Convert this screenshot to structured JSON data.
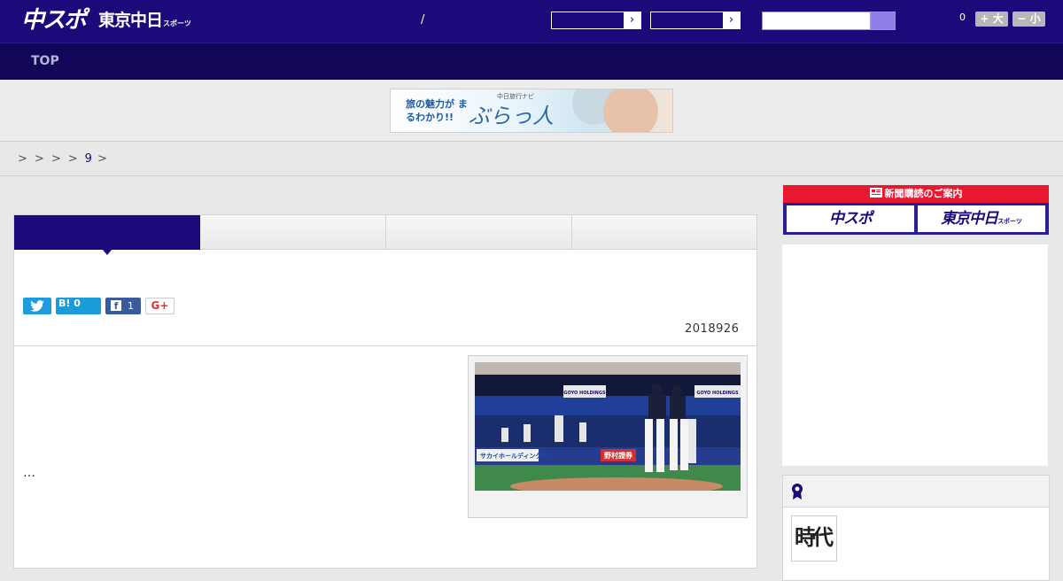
{
  "header": {
    "logo_main": "中スポ",
    "logo_sub": "東京中日",
    "logo_sub_small": "スポーツ",
    "slash": "/",
    "select_arrow_glyph": "›",
    "font_size_count": "0",
    "font_larger_label": "+ 大",
    "font_smaller_label": "− 小"
  },
  "nav": {
    "top_label": "TOP"
  },
  "banner": {
    "catch": "旅の魅力が まるわかり!!",
    "brand_small": "中日旅行ナビ",
    "brand_big": "ぶらっ人"
  },
  "breadcrumb": {
    "seps": [
      ">",
      ">",
      ">",
      ">"
    ],
    "last_num": "9",
    "trail": ">"
  },
  "article": {
    "share": {
      "hatena_label": "B!",
      "hatena_count": "0",
      "facebook_count": "1",
      "gplus_label": "G+"
    },
    "date": "2018926",
    "ellipsis": "…",
    "photo_signs": {
      "sakai": "サカイホールディングス",
      "nomura": "野村證券",
      "goyo": "GOYO HOLDINGS"
    }
  },
  "sidebar": {
    "promo_title": "新聞購読のご案内",
    "promo_btn_1": "中スポ",
    "promo_btn_2": "東京中日",
    "promo_btn_2_small": "スポーツ",
    "thumb_text": "時代"
  },
  "colors": {
    "brand_navy": "#1a0a7a",
    "nav_dark": "#120659",
    "promo_red": "#e8192f"
  }
}
